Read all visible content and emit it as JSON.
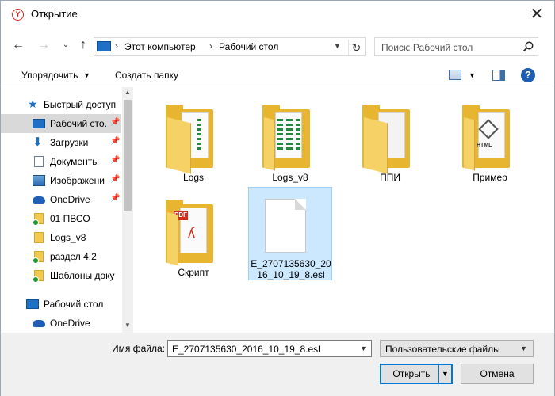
{
  "window": {
    "title": "Открытие",
    "close_glyph": "✕"
  },
  "nav": {
    "back_glyph": "←",
    "forward_glyph": "→",
    "recent_glyph": "⌄",
    "up_glyph": "↑",
    "breadcrumbs": [
      "Этот компьютер",
      "Рабочий стол"
    ],
    "refresh_glyph": "↻",
    "search_placeholder": "Поиск: Рабочий стол"
  },
  "toolbar": {
    "organize_label": "Упорядочить",
    "new_folder_label": "Создать папку",
    "help_glyph": "?"
  },
  "sidebar": {
    "items": [
      {
        "label": "Быстрый доступ",
        "icon": "star-icon",
        "pinned": false
      },
      {
        "label": "Рабочий сто.",
        "icon": "desktop-icon",
        "pinned": true,
        "selected": true
      },
      {
        "label": "Загрузки",
        "icon": "download-icon",
        "pinned": true
      },
      {
        "label": "Документы",
        "icon": "documents-icon",
        "pinned": true
      },
      {
        "label": "Изображени",
        "icon": "pictures-icon",
        "pinned": true
      },
      {
        "label": "OneDrive",
        "icon": "onedrive-icon",
        "pinned": true
      },
      {
        "label": "01 ПВСО",
        "icon": "folder-synced-icon",
        "pinned": false
      },
      {
        "label": "Logs_v8",
        "icon": "folder-icon",
        "pinned": false
      },
      {
        "label": "раздел 4.2",
        "icon": "folder-synced-icon",
        "pinned": false
      },
      {
        "label": "Шаблоны доку",
        "icon": "folder-synced-icon",
        "pinned": false
      },
      {
        "label": "Рабочий стол",
        "icon": "desktop-icon",
        "pinned": false
      },
      {
        "label": "OneDrive",
        "icon": "onedrive-icon",
        "pinned": false
      }
    ]
  },
  "content": {
    "items": [
      {
        "name": "Logs",
        "type": "folder"
      },
      {
        "name": "Logs_v8",
        "type": "folder"
      },
      {
        "name": "ППИ",
        "type": "folder"
      },
      {
        "name": "Пример",
        "type": "folder"
      },
      {
        "name": "Скрипт",
        "type": "folder"
      },
      {
        "name_line1": "E_2707135630_20",
        "name_line2": "16_10_19_8.esl",
        "type": "file",
        "selected": true
      }
    ]
  },
  "bottom": {
    "filename_label": "Имя файла:",
    "filename_value": "E_2707135630_2016_10_19_8.esl",
    "filetype_value": "Пользовательские файлы",
    "open_label": "Открыть",
    "cancel_label": "Отмена"
  },
  "colors": {
    "accent": "#0078d7",
    "selection": "#cce8ff",
    "folder": "#f4c94f"
  }
}
